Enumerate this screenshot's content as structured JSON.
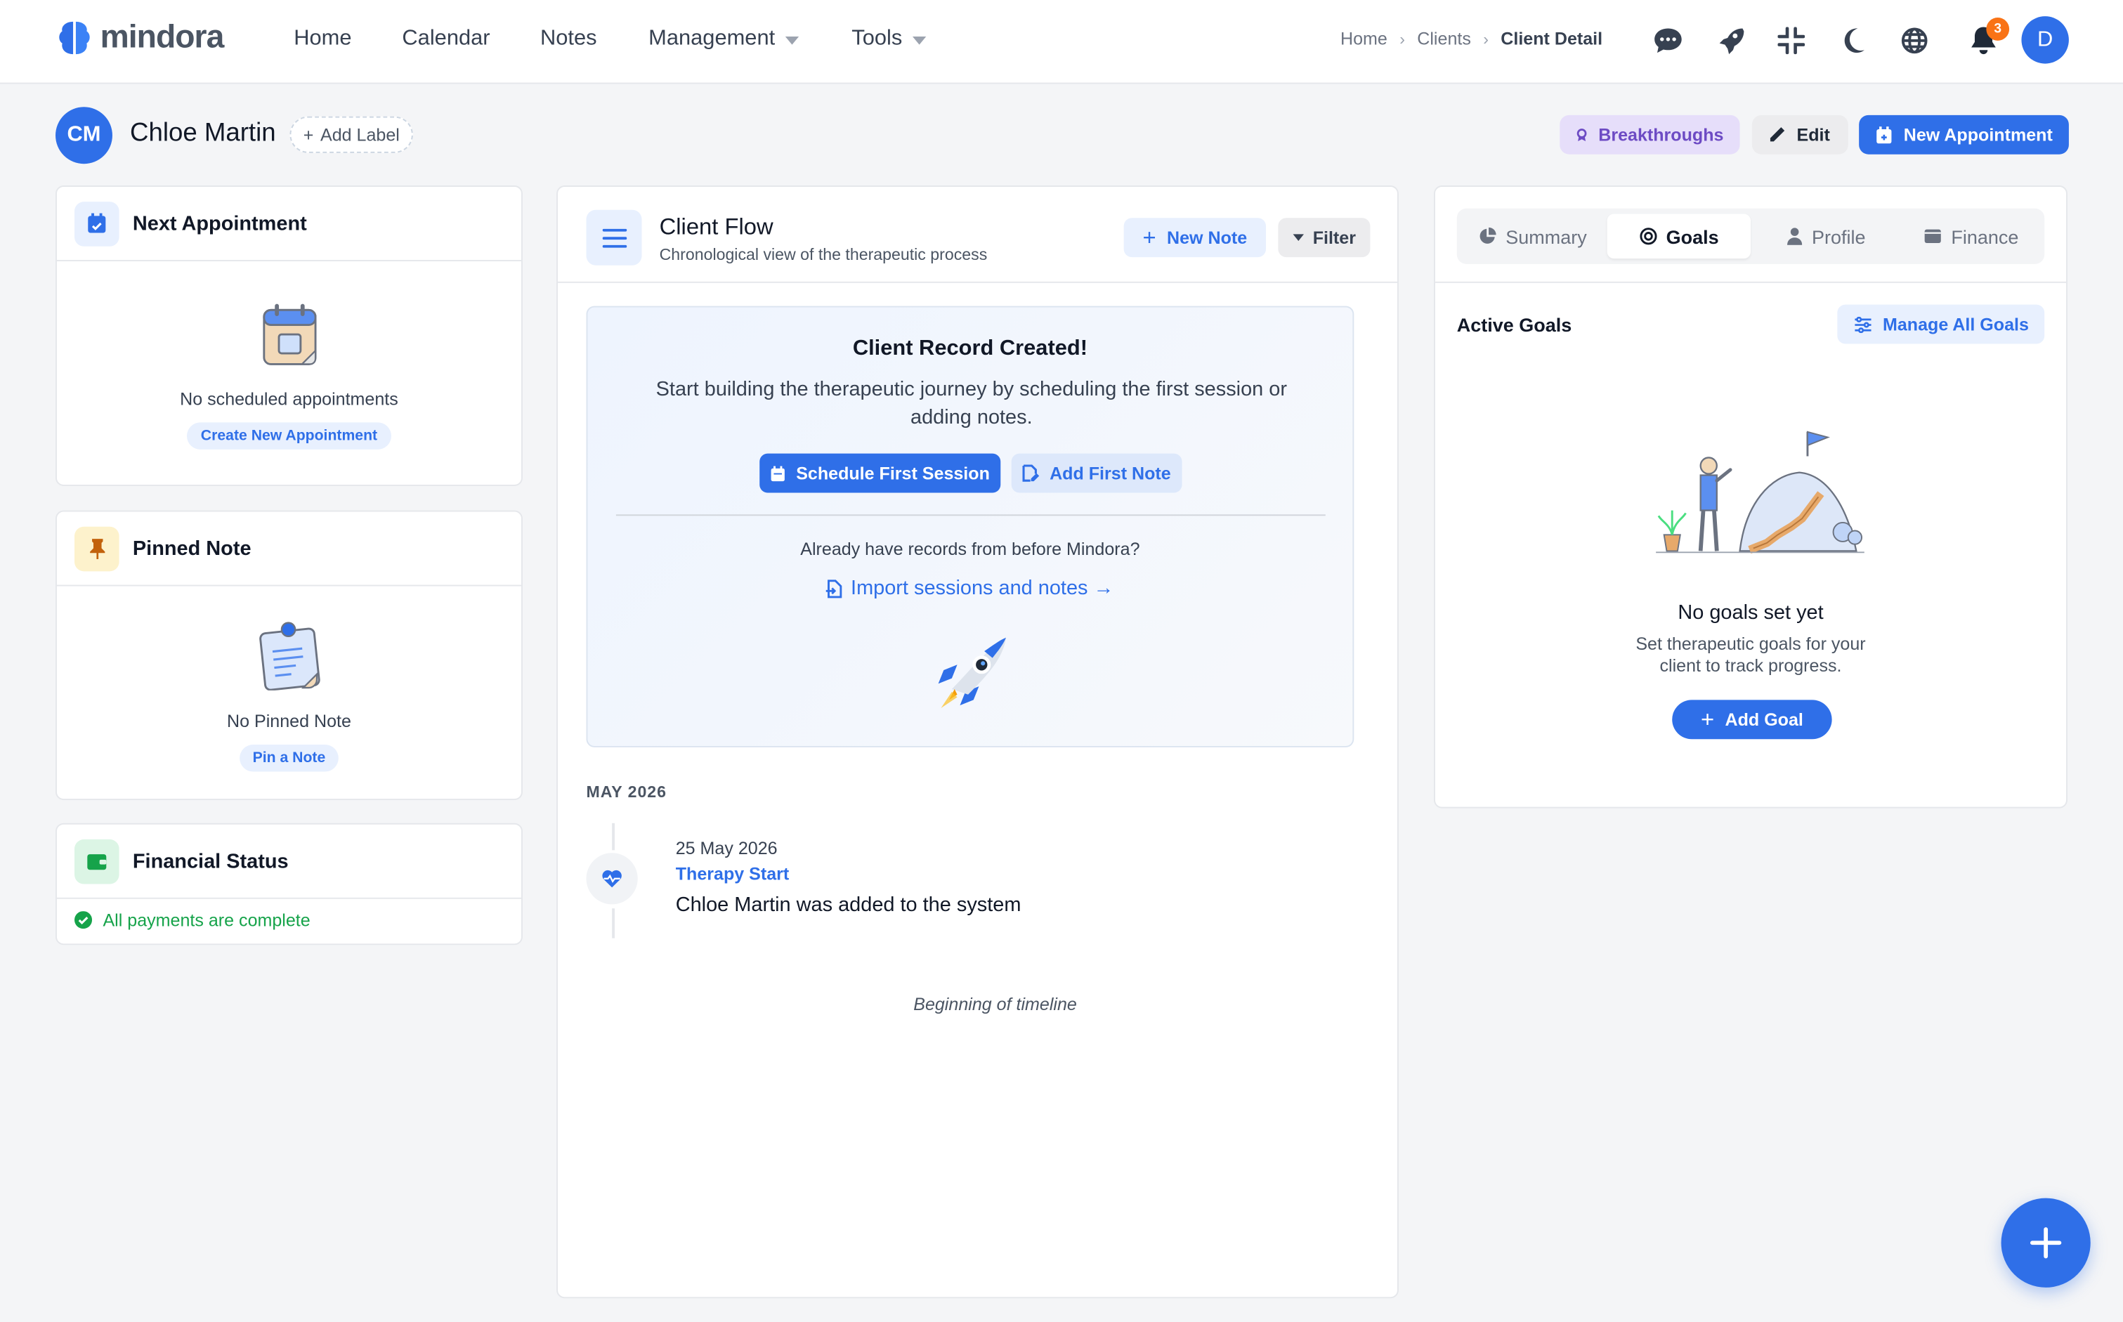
{
  "brand": {
    "name": "mindora",
    "accent": "#2f6fe8"
  },
  "nav": {
    "home": "Home",
    "calendar": "Calendar",
    "notes": "Notes",
    "management": "Management",
    "tools": "Tools"
  },
  "breadcrumb": {
    "home": "Home",
    "clients": "Clients",
    "current": "Client Detail"
  },
  "top_icons": [
    "chat-icon",
    "rocket-icon",
    "collapse-icon",
    "moon-icon",
    "globe-icon",
    "bell-icon"
  ],
  "notifications": {
    "count": "3"
  },
  "user": {
    "initial": "D"
  },
  "client": {
    "initials": "CM",
    "name": "Chloe Martin",
    "add_label": "Add Label"
  },
  "header_actions": {
    "breakthroughs": "Breakthroughs",
    "edit": "Edit",
    "new_appointment": "New Appointment"
  },
  "next_appointment": {
    "title": "Next Appointment",
    "empty": "No scheduled appointments",
    "action": "Create New Appointment"
  },
  "pinned_note": {
    "title": "Pinned Note",
    "empty": "No Pinned Note",
    "action": "Pin a Note"
  },
  "financial": {
    "title": "Financial Status",
    "status": "All payments are complete",
    "status_color": "#16a34a"
  },
  "flow": {
    "title": "Client Flow",
    "subtitle": "Chronological view of the therapeutic process",
    "new_note": "New Note",
    "filter": "Filter",
    "record": {
      "title": "Client Record Created!",
      "description": "Start building the therapeutic journey by scheduling the first session or adding notes.",
      "schedule": "Schedule First Session",
      "add_note": "Add First Note",
      "already": "Already have records from before Mindora?",
      "import": "Import sessions and notes →"
    },
    "month": "MAY 2026",
    "event": {
      "date": "25 May 2026",
      "type": "Therapy Start",
      "text": "Chloe Martin was added to the system"
    },
    "end": "Beginning of timeline"
  },
  "tabs": {
    "summary": "Summary",
    "goals": "Goals",
    "profile": "Profile",
    "finance": "Finance",
    "active": "Goals"
  },
  "goals": {
    "title": "Active Goals",
    "manage": "Manage All Goals",
    "empty_title": "No goals set yet",
    "empty_desc": "Set therapeutic goals for your client to track progress.",
    "add": "Add Goal"
  }
}
